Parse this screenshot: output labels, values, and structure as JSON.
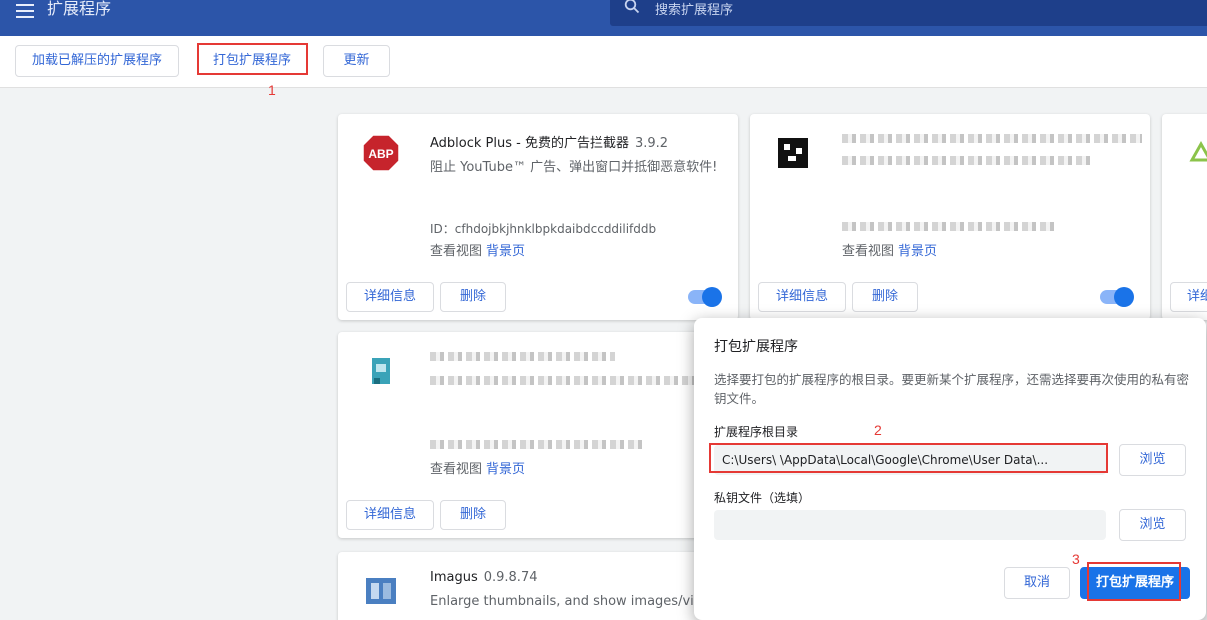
{
  "header": {
    "title": "扩展程序",
    "search_placeholder": "搜索扩展程序"
  },
  "toolbar": {
    "load_unpacked": "加载已解压的扩展程序",
    "pack_extension": "打包扩展程序",
    "update": "更新"
  },
  "annotations": {
    "n1": "1",
    "n2": "2",
    "n3": "3"
  },
  "cards": [
    {
      "name": "Adblock Plus - 免费的广告拦截器",
      "version": "3.9.2",
      "desc": "阻止 YouTube™ 广告、弹出窗口并抵御恶意软件!",
      "id": "ID：cfhdojbkjhnklbpkdaibdccddilifddb",
      "view_label": "查看视图",
      "view_link": "背景页",
      "details": "详细信息",
      "remove": "删除"
    },
    {
      "view_label": "查看视图",
      "view_link": "背景页",
      "details": "详细信息",
      "remove": "删除"
    },
    {
      "details": "详细"
    },
    {
      "view_label": "查看视图",
      "view_link": "背景页",
      "details": "详细信息",
      "remove": "删除"
    },
    {
      "name": "Imagus",
      "version": "0.9.8.74",
      "desc": "Enlarge thumbnails, and show images/videos"
    }
  ],
  "dialog": {
    "title": "打包扩展程序",
    "desc": "选择要打包的扩展程序的根目录。要更新某个扩展程序，还需选择要再次使用的私有密钥文件。",
    "root_label": "扩展程序根目录",
    "root_value": "C:\\Users\\        \\AppData\\Local\\Google\\Chrome\\User Data\\...",
    "key_label": "私钥文件（选填）",
    "key_value": "",
    "browse": "浏览",
    "cancel": "取消",
    "pack": "打包扩展程序"
  },
  "colors": {
    "header": "#2c55a9",
    "accent": "#3367d6",
    "primary": "#1a73e8",
    "annotation": "#e53935"
  }
}
